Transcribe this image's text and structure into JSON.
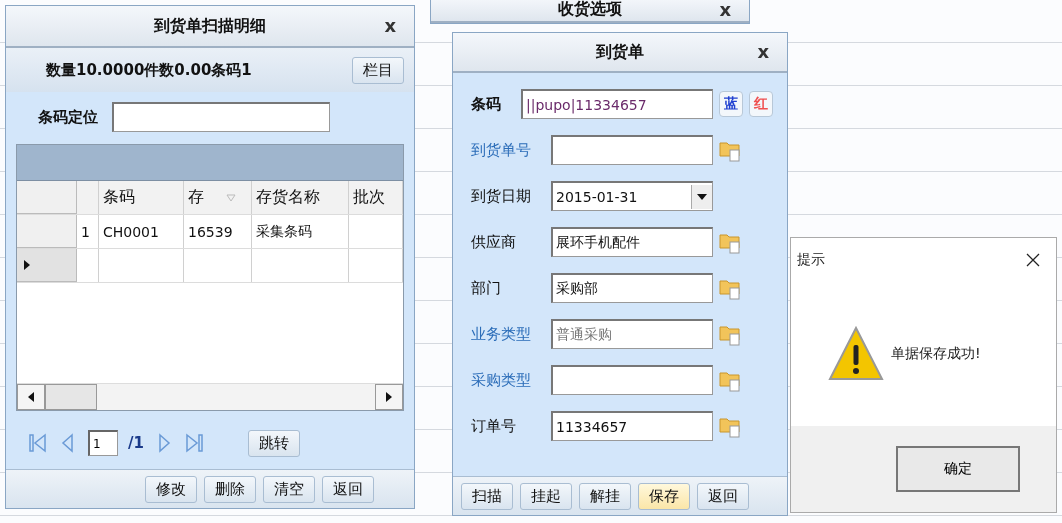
{
  "back_window": {
    "title": "收货选项",
    "close": "x"
  },
  "scan_detail": {
    "title": "到货单扫描明细",
    "close": "x",
    "summary": "数量10.0000件数0.00条码1",
    "columns_button": "栏目",
    "locate_label": "条码定位",
    "grid": {
      "columns": [
        "条码",
        "存",
        "存货名称",
        "批次"
      ],
      "rows": [
        {
          "number": "1",
          "cells": [
            "CH0001",
            "16539",
            "采集条码",
            ""
          ],
          "current": false
        },
        {
          "number": "",
          "cells": [
            "",
            "",
            "",
            ""
          ],
          "current": true
        }
      ]
    },
    "pager": {
      "page": "1",
      "total": "/1",
      "jump": "跳转"
    },
    "buttons": [
      "修改",
      "删除",
      "清空",
      "返回"
    ]
  },
  "arrival": {
    "title": "到货单",
    "close": "x",
    "barcode_label": "条码",
    "barcode_value": "||pupo|11334657",
    "mark_buttons": [
      "蓝",
      "红"
    ],
    "fields": [
      {
        "label": "到货单号",
        "kind": "lookup",
        "link": true,
        "disabled": false
      },
      {
        "label": "到货日期",
        "value": "2015-01-31",
        "kind": "date",
        "link": false,
        "disabled": false
      },
      {
        "label": "供应商",
        "value": "展环手机配件",
        "kind": "lookup",
        "link": false,
        "disabled": false
      },
      {
        "label": "部门",
        "value": "采购部",
        "kind": "lookup",
        "link": false,
        "disabled": false
      },
      {
        "label": "业务类型",
        "value": "普通采购",
        "kind": "lookup",
        "link": true,
        "disabled": true
      },
      {
        "label": "采购类型",
        "kind": "lookup",
        "link": true,
        "disabled": false
      },
      {
        "label": "订单号",
        "value": "11334657",
        "kind": "lookup",
        "link": false,
        "disabled": false
      }
    ],
    "buttons": [
      {
        "label": "扫描",
        "default": false
      },
      {
        "label": "挂起",
        "default": false
      },
      {
        "label": "解挂",
        "default": false
      },
      {
        "label": "保存",
        "default": true
      },
      {
        "label": "返回",
        "default": false
      }
    ]
  },
  "message_box": {
    "title": "提示",
    "message": "单据保存成功!",
    "ok": "确定"
  }
}
